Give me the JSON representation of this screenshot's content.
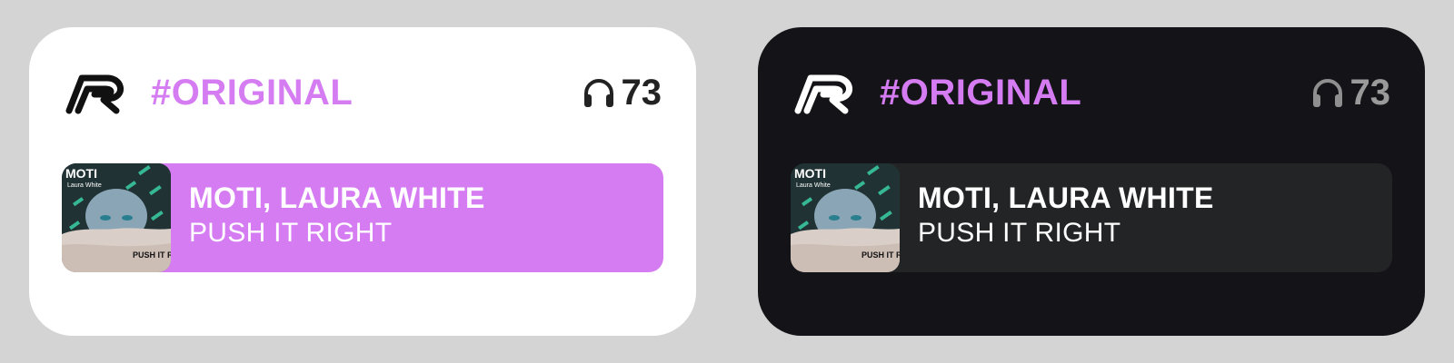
{
  "colors": {
    "accent": "#d57cf2",
    "dark_bg": "#141418",
    "light_bg": "#ffffff"
  },
  "cards": [
    {
      "theme": "light",
      "logo_icon": "r-logo-icon",
      "tag": "#ORIGINAL",
      "listener_icon": "headphones-icon",
      "listeners": "73",
      "track": {
        "artist": "MOTI, LAURA WHITE",
        "title": "PUSH IT RIGHT",
        "art_top_text": "MOTI",
        "art_sub_text": "Laura White",
        "art_bottom_text": "PUSH IT RIGHT"
      }
    },
    {
      "theme": "dark",
      "logo_icon": "r-logo-icon",
      "tag": "#ORIGINAL",
      "listener_icon": "headphones-icon",
      "listeners": "73",
      "track": {
        "artist": "MOTI, LAURA WHITE",
        "title": "PUSH IT RIGHT",
        "art_top_text": "MOTI",
        "art_sub_text": "Laura White",
        "art_bottom_text": "PUSH IT RIGHT"
      }
    }
  ]
}
